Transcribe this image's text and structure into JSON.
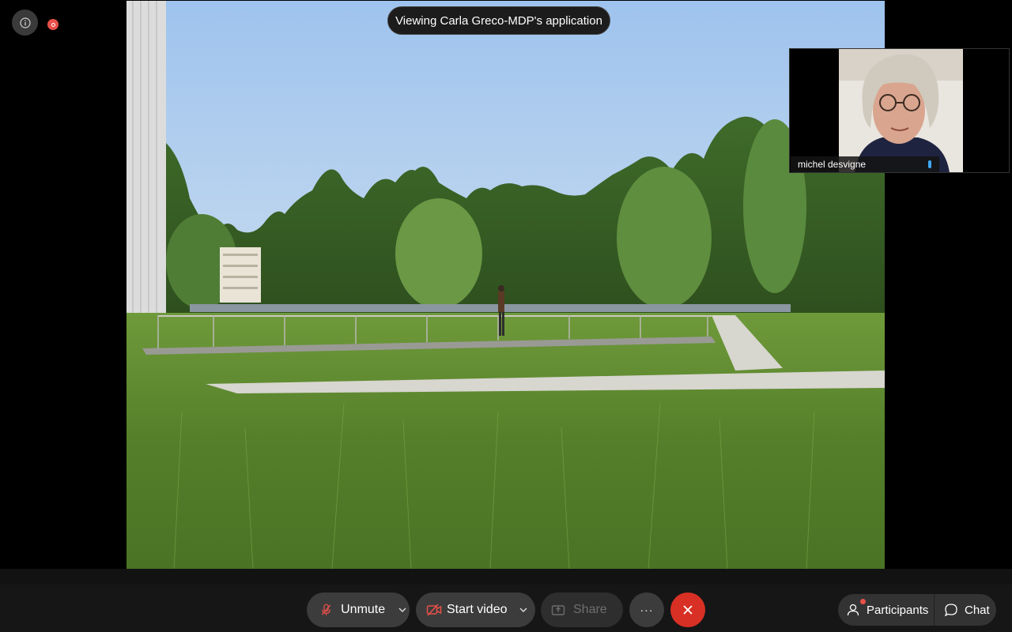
{
  "meeting": {
    "viewing_banner": "Viewing Carla Greco-MDP's application"
  },
  "participant_tile": {
    "name": "michel desvigne"
  },
  "toolbar": {
    "unmute_label": "Unmute",
    "start_video_label": "Start video",
    "share_label": "Share",
    "more_label": "···",
    "participants_label": "Participants",
    "chat_label": "Chat"
  },
  "colors": {
    "end_call": "#d93025",
    "recording_indicator": "#e8504a",
    "audio_level": "#3fa9f5",
    "muted_icon": "#e8504a"
  },
  "icons": {
    "info": "info-icon",
    "recording": "recording-icon",
    "mic_muted": "microphone-off-icon",
    "video_off": "camera-off-icon",
    "share": "share-screen-icon",
    "more": "more-icon",
    "end": "close-icon",
    "participants": "participants-icon",
    "chat": "chat-icon"
  }
}
